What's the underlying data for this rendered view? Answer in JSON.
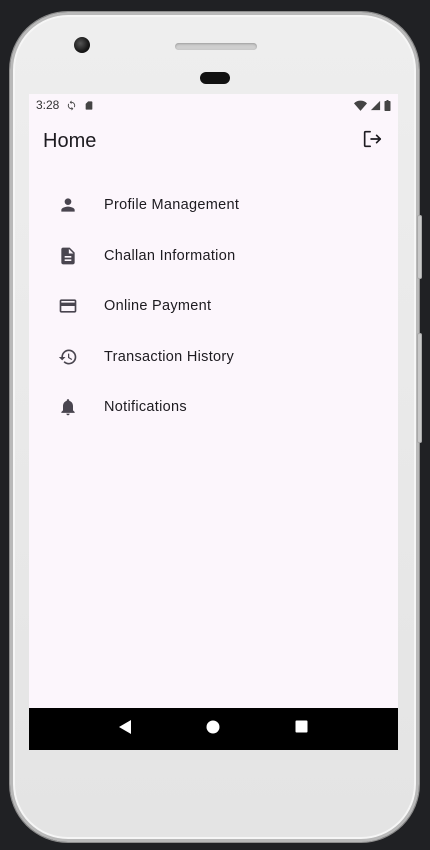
{
  "status_bar": {
    "time": "3:28",
    "icons": [
      "sync-icon",
      "sim-card-icon",
      "wifi-icon",
      "signal-icon",
      "battery-icon"
    ]
  },
  "app_bar": {
    "title": "Home",
    "action_icon": "logout-icon"
  },
  "menu": {
    "items": [
      {
        "label": "Profile Management",
        "icon": "person-icon"
      },
      {
        "label": "Challan Information",
        "icon": "document-icon"
      },
      {
        "label": "Online Payment",
        "icon": "credit-card-icon"
      },
      {
        "label": "Transaction History",
        "icon": "history-icon"
      },
      {
        "label": "Notifications",
        "icon": "bell-icon"
      }
    ]
  },
  "nav_bar": {
    "buttons": [
      "back-icon",
      "home-icon",
      "recents-icon"
    ]
  },
  "colors": {
    "screen_bg": "#fcf6fc",
    "text": "#1d1b20",
    "icon": "#49454f",
    "nav_bar": "#000000"
  }
}
